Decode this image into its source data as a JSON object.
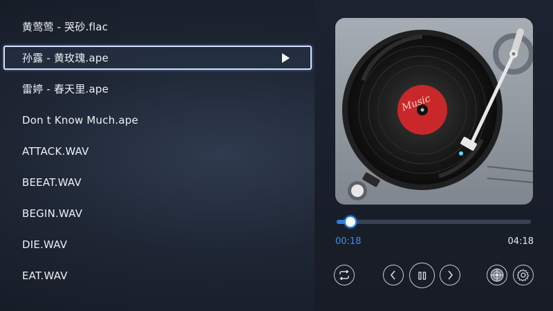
{
  "playlist": {
    "tracks": [
      {
        "title": "黄莺莺 - 哭砂.flac",
        "active": false
      },
      {
        "title": "孙露 - 黄玫瑰.ape",
        "active": true
      },
      {
        "title": "雷婷 - 春天里.ape",
        "active": false
      },
      {
        "title": "Don t Know Much.ape",
        "active": false
      },
      {
        "title": "ATTACK.WAV",
        "active": false
      },
      {
        "title": "BEEAT.WAV",
        "active": false
      },
      {
        "title": "BEGIN.WAV",
        "active": false
      },
      {
        "title": "DIE.WAV",
        "active": false
      },
      {
        "title": "EAT.WAV",
        "active": false
      }
    ]
  },
  "player": {
    "record_label_text": "Music",
    "current_time": "00:18",
    "total_time": "04:18",
    "progress_fraction": 0.07,
    "colors": {
      "accent": "#2a7fe0",
      "record_label": "#c8282a"
    },
    "controls": {
      "repeat_icon": "repeat-icon",
      "prev_icon": "chevron-left-icon",
      "pause_icon": "pause-icon",
      "next_icon": "chevron-right-icon",
      "visualizer_icon": "visualizer-icon",
      "settings_icon": "gear-icon"
    }
  }
}
